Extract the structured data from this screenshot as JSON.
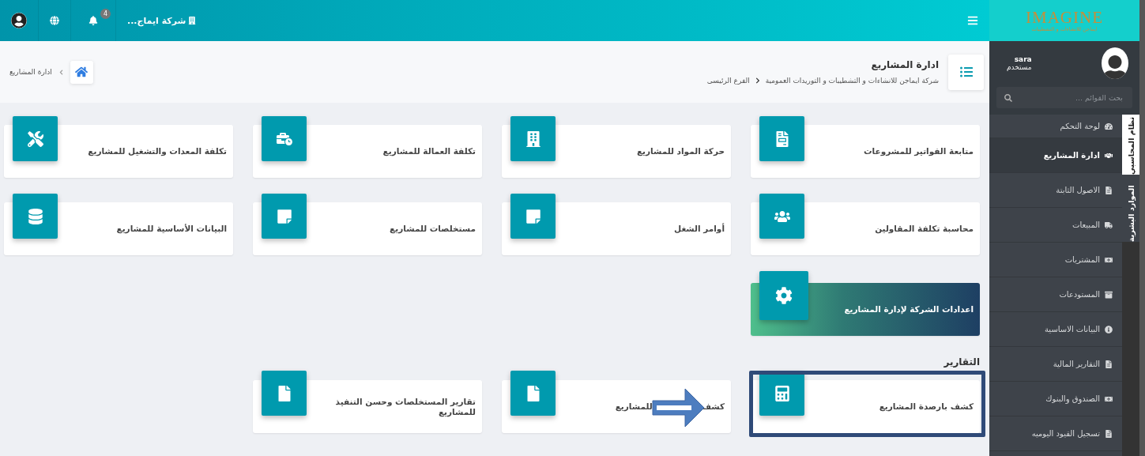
{
  "topbar": {
    "company": "شركة ايماج...",
    "notifications_count": "4"
  },
  "sidebar": {
    "logo": {
      "name": "IMAGINE",
      "tagline": "ايماجن للانشاءات و التشطيبات"
    },
    "user": {
      "name": "sara",
      "role": "مستخدم"
    },
    "search": {
      "placeholder": "بحث القوائم ..."
    },
    "tabs": [
      {
        "label": "نظام المحاسبي",
        "selected": true
      },
      {
        "label": "الموارد البشرية",
        "selected": false
      }
    ],
    "items": [
      {
        "label": "لوحة التحكم",
        "selected": false
      },
      {
        "label": "ادارة المشاريع",
        "selected": true
      },
      {
        "label": "الاصول الثابتة",
        "selected": false
      },
      {
        "label": "المبيعات",
        "selected": false
      },
      {
        "label": "المشتريات",
        "selected": false
      },
      {
        "label": "المستودعات",
        "selected": false
      },
      {
        "label": "البيانات الاساسية",
        "selected": false
      },
      {
        "label": "التقارير المالية",
        "selected": false
      },
      {
        "label": "الصندوق والبنوك",
        "selected": false
      },
      {
        "label": "تسجيل القيود اليوميه",
        "selected": false
      }
    ]
  },
  "page_header": {
    "title": "ادارة المشاريع",
    "breadcrumb": [
      "شركة ايماجن للانشاءات و التشطيبات و التوريدات العمومية",
      "الفرع الرئيسى"
    ],
    "current_page": "ادارة المشاريع"
  },
  "cards": [
    {
      "kind": "tile",
      "label": "متابعة الفواتير للمشروعات"
    },
    {
      "kind": "tile",
      "label": "حركة المواد للمشاريع"
    },
    {
      "kind": "tile",
      "label": "تكلفة العمالة للمشاريع"
    },
    {
      "kind": "tile",
      "label": "تكلفة المعدات والتشغيل للمشاريع"
    },
    {
      "kind": "tile",
      "label": "محاسبة تكلفة المقاولين"
    },
    {
      "kind": "tile",
      "label": "أوامر الشغل"
    },
    {
      "kind": "tile",
      "label": "مستخلصات للمشاريع"
    },
    {
      "kind": "tile",
      "label": "البيانات الأساسية للمشاريع"
    },
    {
      "kind": "feature",
      "label": "اعدادات الشركة لإدارة المشاريع"
    }
  ],
  "reports": {
    "title": "التقارير",
    "cards": [
      {
        "label_parts": [
          "كشف بارصدة المشاريع"
        ],
        "framed": true,
        "arrow": false
      },
      {
        "label_parts": [
          "كشف",
          "للمشاريع"
        ],
        "framed": false,
        "arrow": true
      },
      {
        "label_parts": [
          "تقارير المستخلصات وحسن التنفيذ للمشاريع"
        ],
        "framed": false,
        "arrow": false
      }
    ]
  }
}
